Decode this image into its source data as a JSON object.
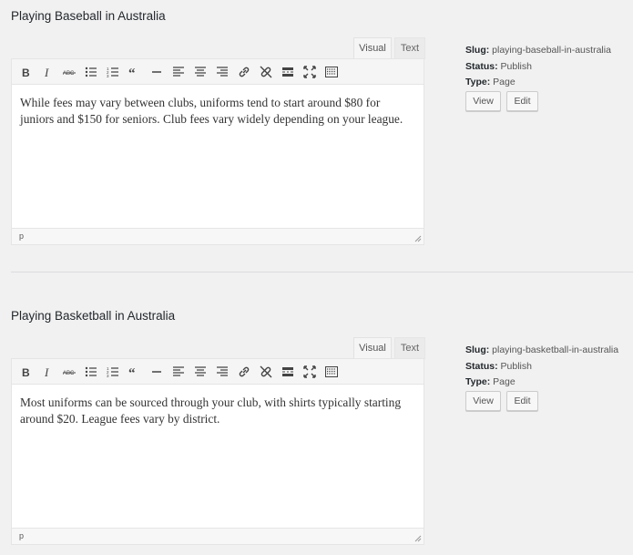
{
  "pages": [
    {
      "title": "Playing Baseball in Australia",
      "tabs": {
        "visual": "Visual",
        "text": "Text"
      },
      "content": "While fees may vary between clubs, uniforms tend to start around $80 for juniors and $150 for seniors. Club fees vary widely depending on your league.",
      "status_path": "p",
      "meta": {
        "slug_label": "Slug:",
        "slug": "playing-baseball-in-australia",
        "status_label": "Status:",
        "status": "Publish",
        "type_label": "Type:",
        "type": "Page"
      },
      "buttons": {
        "view": "View",
        "edit": "Edit"
      }
    },
    {
      "title": "Playing Basketball in Australia",
      "tabs": {
        "visual": "Visual",
        "text": "Text"
      },
      "content": "Most uniforms can be sourced through your club, with shirts typically starting around $20. League fees vary by district.",
      "status_path": "p",
      "meta": {
        "slug_label": "Slug:",
        "slug": "playing-basketball-in-australia",
        "status_label": "Status:",
        "status": "Publish",
        "type_label": "Type:",
        "type": "Page"
      },
      "buttons": {
        "view": "View",
        "edit": "Edit"
      }
    }
  ],
  "toolbar_icons": [
    "bold-icon",
    "italic-icon",
    "strikethrough-icon",
    "bullet-list-icon",
    "numbered-list-icon",
    "blockquote-icon",
    "horizontal-rule-icon",
    "align-left-icon",
    "align-center-icon",
    "align-right-icon",
    "link-icon",
    "unlink-icon",
    "read-more-icon",
    "fullscreen-icon",
    "toolbar-toggle-icon"
  ],
  "colors": {
    "background": "#f1f1f1",
    "editor_bg": "#ffffff",
    "toolbar_bg": "#f5f5f5",
    "icon": "#444444"
  }
}
